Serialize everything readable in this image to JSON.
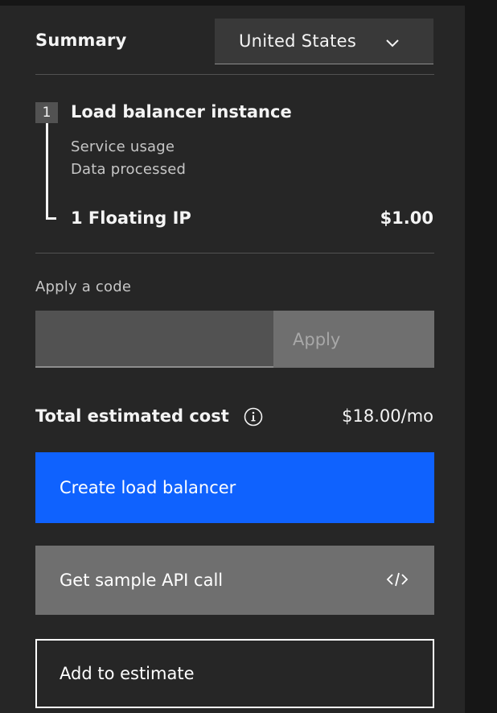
{
  "summary": {
    "title": "Summary",
    "region": "United States"
  },
  "line_item": {
    "step_number": "1",
    "title": "Load balancer instance",
    "details": [
      "Service usage",
      "Data processed"
    ],
    "floating_ip_label": "1 Floating IP",
    "floating_ip_price": "$1.00"
  },
  "promo": {
    "label": "Apply a code",
    "input_value": "",
    "apply_label": "Apply"
  },
  "total": {
    "label": "Total estimated cost",
    "value": "$18.00/mo"
  },
  "actions": {
    "create_label": "Create load balancer",
    "api_label": "Get sample API call",
    "estimate_label": "Add to estimate"
  },
  "icons": {
    "region_dropdown": "chevron-down-icon",
    "total_info": "info-icon",
    "api": "code-icon"
  },
  "colors": {
    "primary": "#0f62fe",
    "panel_bg": "#262626",
    "page_bg": "#161616"
  }
}
